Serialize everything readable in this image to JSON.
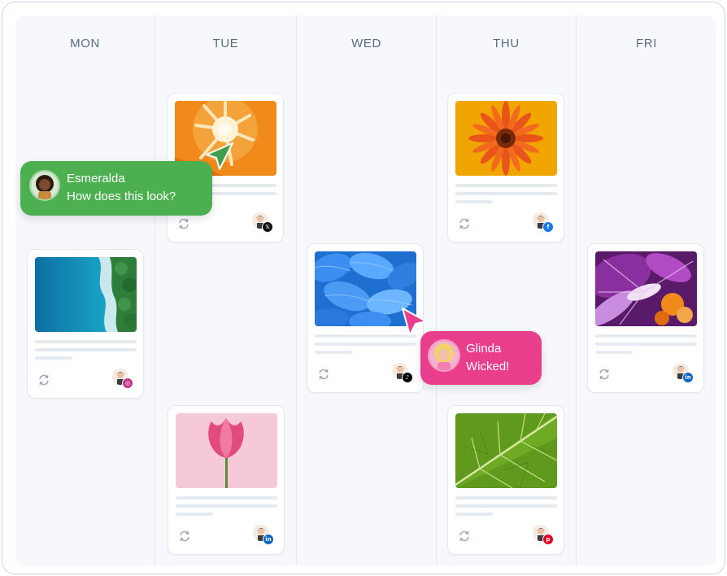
{
  "days": [
    "MON",
    "TUE",
    "WED",
    "THU",
    "FRI"
  ],
  "colors": {
    "frame_border": "#cdd7e3",
    "board_bg": "#f6f8fc",
    "day_header": "#5a6b80",
    "green_bubble": "#4caf50",
    "pink_bubble": "#e83e8c"
  },
  "posts": [
    {
      "day": "MON",
      "image": "aerial-ocean-coast",
      "network": "instagram-icon",
      "network_color": "#c13584"
    },
    {
      "day": "TUE",
      "image": "orange-citrus-macro",
      "network": "x-icon",
      "network_color": "#111111"
    },
    {
      "day": "TUE",
      "image": "pink-tulip",
      "network": "linkedin-icon",
      "network_color": "#0a66c2"
    },
    {
      "day": "WED",
      "image": "blue-petals",
      "network": "tiktok-icon",
      "network_color": "#000000"
    },
    {
      "day": "THU",
      "image": "orange-flower",
      "network": "facebook-icon",
      "network_color": "#1877f2"
    },
    {
      "day": "THU",
      "image": "green-leaf-macro",
      "network": "pinterest-icon",
      "network_color": "#e60023"
    },
    {
      "day": "FRI",
      "image": "purple-orange-paint-splash",
      "network": "linkedin-icon",
      "network_color": "#0a66c2"
    }
  ],
  "comments": [
    {
      "name": "Esmeralda",
      "text": "How does this look?"
    },
    {
      "name": "Glinda",
      "text": "Wicked!"
    }
  ]
}
